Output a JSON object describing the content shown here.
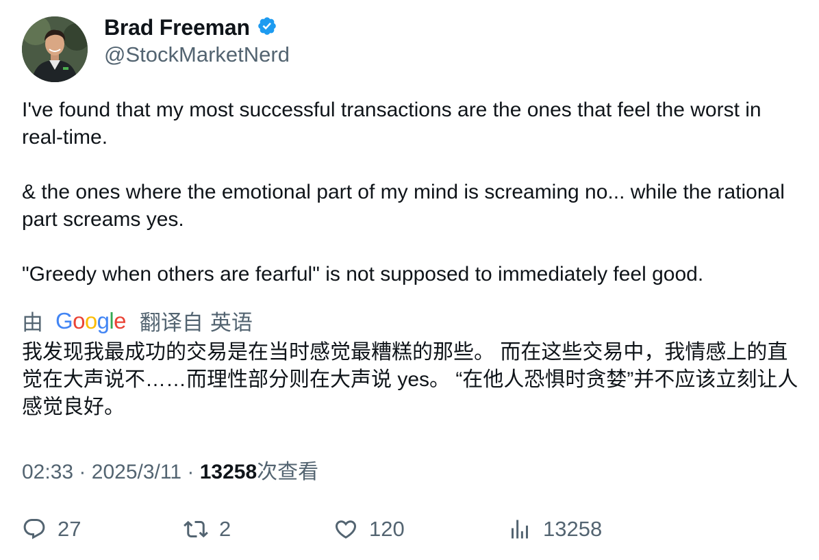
{
  "author": {
    "display_name": "Brad Freeman",
    "handle": "@StockMarketNerd",
    "verified_icon": "verified-badge-icon",
    "verified_color": "#1d9bf0"
  },
  "tweet": {
    "paragraphs": [
      "I've found that my most successful transactions are the ones that feel the worst in real-time.",
      "& the ones where the emotional part of my mind is screaming no... while the rational part screams yes.",
      "\"Greedy when others are fearful\" is not supposed to immediately feel good."
    ]
  },
  "translation": {
    "prefix": "由",
    "provider": "Google",
    "suffix": "翻译自",
    "language": "英语",
    "text": "我发现我最成功的交易是在当时感觉最糟糕的那些。 而在这些交易中，我情感上的直觉在大声说不……而理性部分则在大声说 yes。 “在他人恐惧时贪婪”并不应该立刻让人感觉良好。"
  },
  "meta": {
    "time": "02:33",
    "separator": "·",
    "date": "2025/3/11",
    "views_count": "13258",
    "views_label": "次查看"
  },
  "actions": {
    "replies": {
      "icon": "reply-icon",
      "count": "27"
    },
    "retweets": {
      "icon": "retweet-icon",
      "count": "2"
    },
    "likes": {
      "icon": "like-icon",
      "count": "120"
    },
    "views": {
      "icon": "analytics-icon",
      "count": "13258"
    }
  },
  "colors": {
    "text_primary": "#0f1419",
    "text_secondary": "#536471",
    "accent": "#1d9bf0"
  }
}
